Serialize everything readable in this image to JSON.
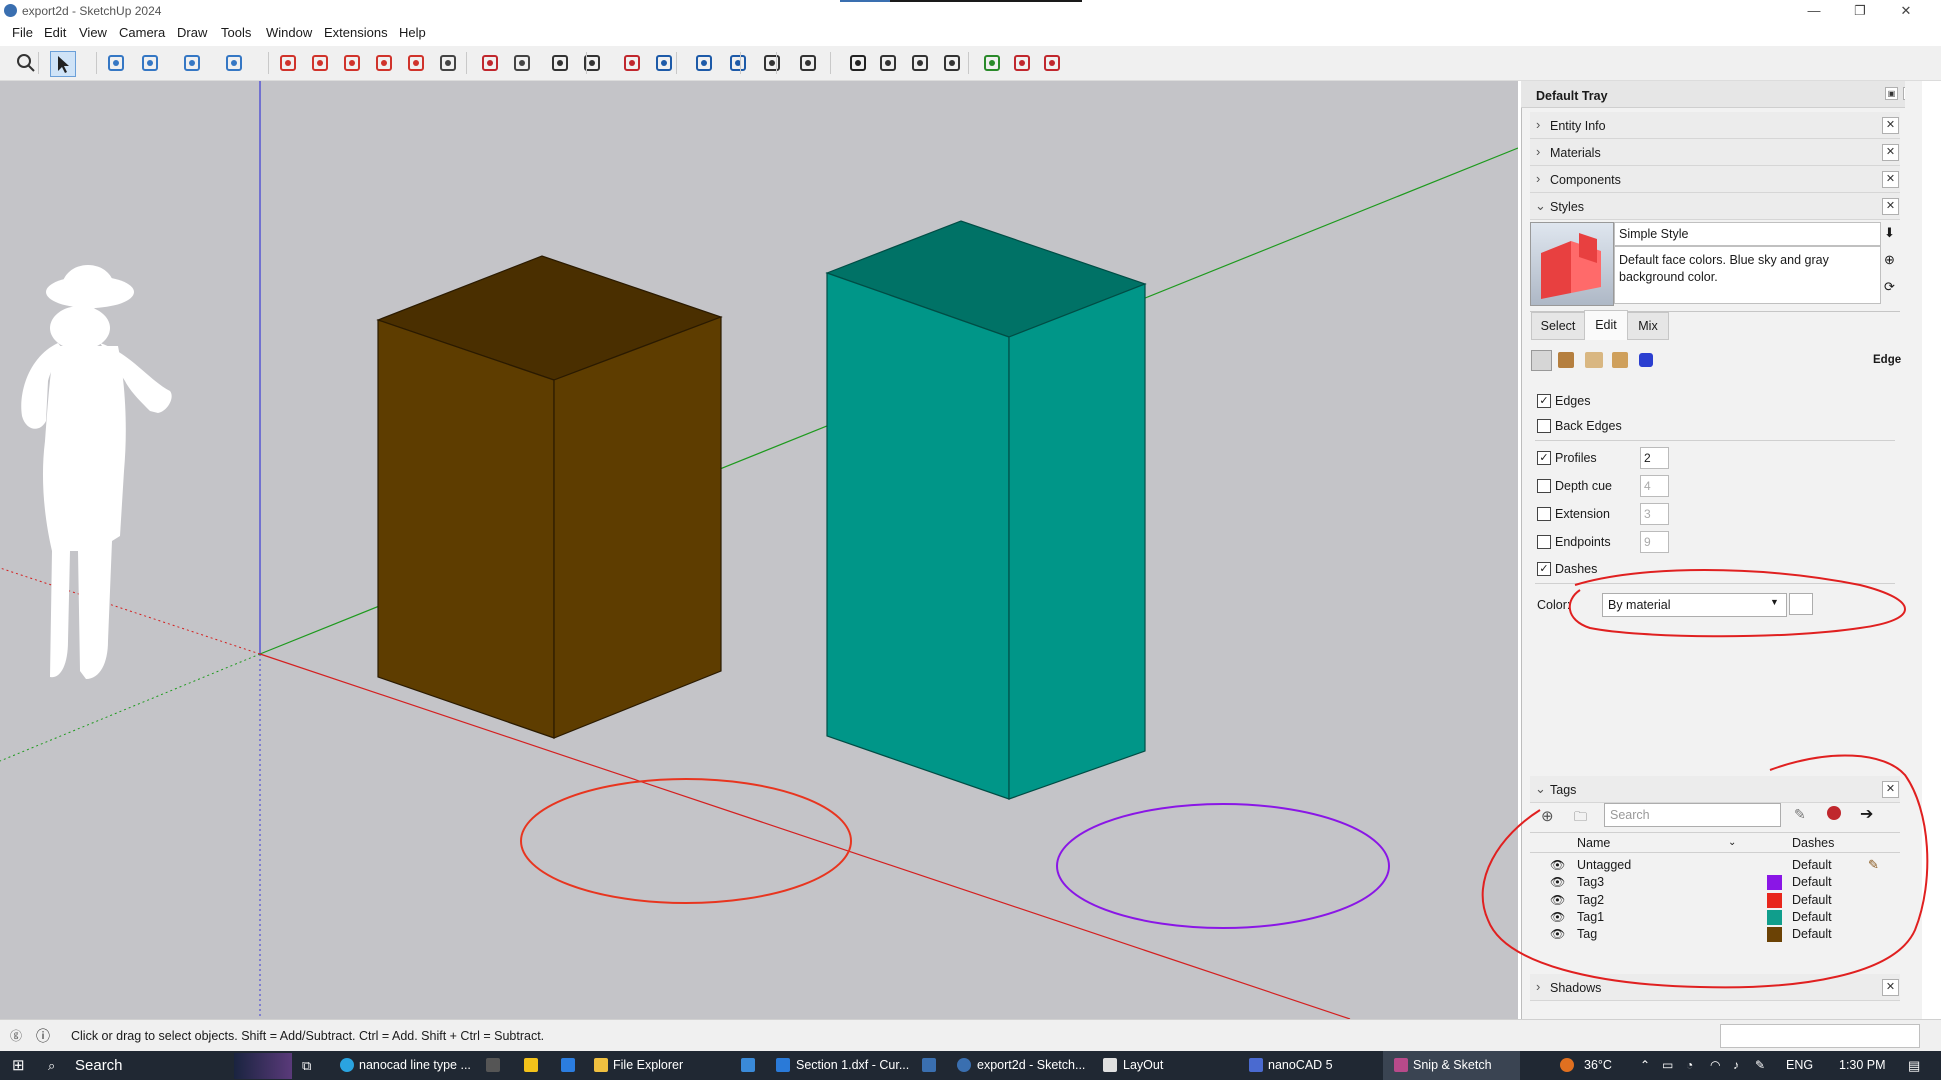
{
  "window": {
    "title": "export2d - SketchUp 2024",
    "controls": {
      "minimize": "—",
      "restore": "❐",
      "close": "✕"
    }
  },
  "menu": [
    "File",
    "Edit",
    "View",
    "Camera",
    "Draw",
    "Tools",
    "Window",
    "Extensions",
    "Help"
  ],
  "toolbar_icons": [
    "search-icon",
    "select-icon",
    "eraser-icon",
    "pencil-icon",
    "line-icon",
    "rectangle-icon",
    "push-pull-icon",
    "follow-me-icon",
    "move-icon",
    "rotate-icon",
    "scale-icon",
    "offset-icon",
    "orbit-icon",
    "pan-icon",
    "zoom-icon",
    "zoom-extents-icon",
    "section-icon",
    "tags-icon",
    "layers-icon",
    "component-icon",
    "account-icon",
    "new-icon",
    "person-icon",
    "outliner-icon",
    "ruby-console-icon",
    "terminal-icon",
    "extension-warehouse-icon",
    "sandbox-icon",
    "report-icon"
  ],
  "tray": {
    "title": "Default Tray",
    "sections": {
      "entity_info": "Entity Info",
      "materials": "Materials",
      "components": "Components",
      "styles": "Styles"
    },
    "style": {
      "name": "Simple Style",
      "description": "Default face colors. Blue sky and gray background color."
    },
    "tabs": {
      "select": "Select",
      "edit": "Edit",
      "mix": "Mix"
    },
    "edge_label": "Edge",
    "settings": {
      "edges": {
        "label": "Edges",
        "checked": true
      },
      "back_edges": {
        "label": "Back Edges",
        "checked": false
      },
      "profiles": {
        "label": "Profiles",
        "checked": true,
        "value": "2"
      },
      "depth_cue": {
        "label": "Depth cue",
        "checked": false,
        "value": "4"
      },
      "extension": {
        "label": "Extension",
        "checked": false,
        "value": "3"
      },
      "endpoints": {
        "label": "Endpoints",
        "checked": false,
        "value": "9"
      },
      "dashes": {
        "label": "Dashes",
        "checked": true
      }
    },
    "color_label": "Color:",
    "color_value": "By material",
    "tags": {
      "title": "Tags",
      "search_placeholder": "Search",
      "col_name": "Name",
      "col_dashes": "Dashes",
      "rows": [
        {
          "name": "Untagged",
          "color": "",
          "dashes": "Default"
        },
        {
          "name": "Tag3",
          "color": "#8a16e6",
          "dashes": "Default"
        },
        {
          "name": "Tag2",
          "color": "#e8261c",
          "dashes": "Default"
        },
        {
          "name": "Tag1",
          "color": "#109e8c",
          "dashes": "Default"
        },
        {
          "name": "Tag",
          "color": "#6b4205",
          "dashes": "Default"
        }
      ]
    },
    "shadows": "Shadows"
  },
  "status": {
    "hint": "Click or drag to select objects. Shift = Add/Subtract. Ctrl = Add. Shift + Ctrl = Subtract."
  },
  "taskbar": {
    "search": "Search",
    "apps": [
      "nanocad line type ...",
      "File Explorer",
      "Section 1.dxf - Cur...",
      "export2d - Sketch...",
      "LayOut",
      "nanoCAD 5",
      "Snip & Sketch"
    ],
    "weather": "36°C",
    "lang": "ENG",
    "time": "1:30 PM"
  },
  "colors": {
    "box_brown_top": "#4a2f00",
    "box_brown_front": "#5e3d00",
    "box_teal_top": "#007266",
    "box_teal_front": "#009688",
    "annotation_red": "#e02020",
    "tag3_purple": "#8a16e6"
  }
}
